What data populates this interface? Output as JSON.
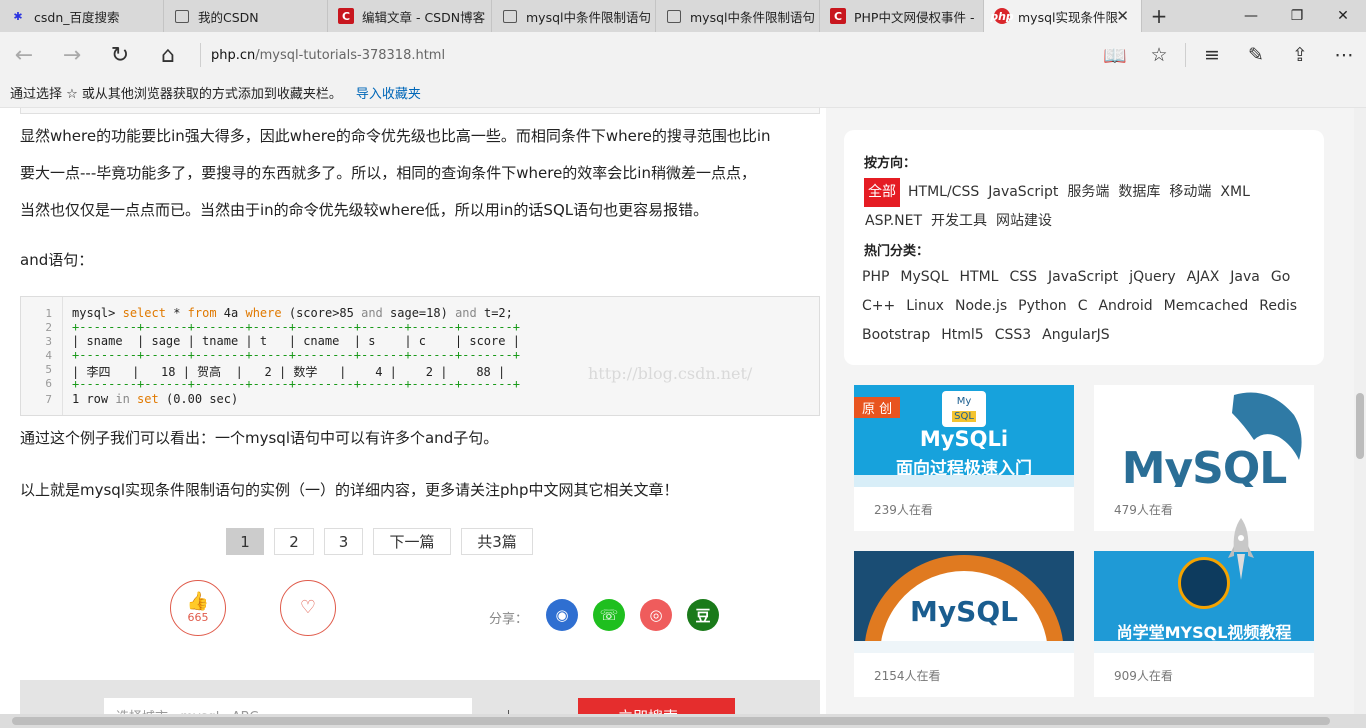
{
  "tabs": [
    {
      "label": "csdn_百度搜索",
      "favicon": "baidu-paw-icon"
    },
    {
      "label": "我的CSDN",
      "favicon": "page-icon"
    },
    {
      "label": "编辑文章 - CSDN博客",
      "favicon": "csdn-icon"
    },
    {
      "label": "mysql中条件限制语句",
      "favicon": "page-icon"
    },
    {
      "label": "mysql中条件限制语句",
      "favicon": "page-icon"
    },
    {
      "label": "PHP中文网侵权事件 -",
      "favicon": "csdn-icon"
    },
    {
      "label": "mysql实现条件限",
      "favicon": "php-icon",
      "active": true
    }
  ],
  "address": {
    "domain": "php.cn",
    "path": "/mysql-tutorials-378318.html"
  },
  "favorites_bar": {
    "text": "通过选择 ☆ 或从其他浏览器获取的方式添加到收藏夹栏。",
    "link": "导入收藏夹"
  },
  "article": {
    "para1_lines": [
      "显然where的功能要比in强大得多，因此where的命令优先级也比高一些。而相同条件下where的搜寻范围也比in",
      "要大一点---毕竟功能多了，要搜寻的东西就多了。所以，相同的查询条件下where的效率会比in稍微差一点点，",
      "当然也仅仅是一点点而已。当然由于in的命令优先级较where低，所以用in的话SQL语句也更容易报错。"
    ],
    "and_heading": "and语句：",
    "code": {
      "line_numbers": [
        "1",
        "2",
        "3",
        "4",
        "5",
        "6",
        "7"
      ],
      "query": {
        "prompt": "mysql>",
        "select": "select",
        "star": "*",
        "from": "from",
        "table": "4a",
        "where": "where",
        "cond1": "(score>85",
        "and1": "and",
        "cond2": "sage=18)",
        "and2": "and",
        "cond3": "t=2;"
      },
      "border": "+--------+------+-------+-----+--------+------+------+-------+",
      "header": "| sname  | sage | tname | t   | cname  | s    | c    | score |",
      "row": "| 李四   |   18 | 贺高  |   2 | 数学   |    4 |    2 |    88 |",
      "result": {
        "count": "1 row",
        "in": "in",
        "set": "set",
        "time": "(0.00 sec)"
      }
    },
    "watermark": "http://blog.csdn.net/",
    "para2": "通过这个例子我们可以看出：一个mysql语句中可以有许多个and子句。",
    "para3": "以上就是mysql实现条件限制语句的实例（一）的详细内容，更多请关注php中文网其它相关文章！",
    "pagination": {
      "pages": [
        "1",
        "2",
        "3"
      ],
      "next": "下一篇",
      "total": "共3篇",
      "current": "1"
    },
    "like_count": "665",
    "share_label": "分享：",
    "share_icons": [
      "qq-icon",
      "wechat-icon",
      "weibo-icon",
      "douban-icon"
    ],
    "douban_char": "豆",
    "search_placeholder": "选择城市 · mysql · ABC",
    "search_button": "立即搜索"
  },
  "sidebar": {
    "direction_label": "按方向：",
    "directions": [
      "全部",
      "HTML/CSS",
      "JavaScript",
      "服务端",
      "数据库",
      "移动端",
      "XML",
      "ASP.NET",
      "开发工具",
      "网站建设"
    ],
    "hot_label": "热门分类：",
    "hot": [
      "PHP",
      "MySQL",
      "HTML",
      "CSS",
      "JavaScript",
      "jQuery",
      "AJAX",
      "Java",
      "Go",
      "C++",
      "Linux",
      "Node.js",
      "Python",
      "C",
      "Android",
      "Memcached",
      "Redis",
      "Bootstrap",
      "Html5",
      "CSS3",
      "AngularJS"
    ],
    "cards": [
      {
        "viewers": "239人在看",
        "badge": "原 创",
        "title1": "MySQLi",
        "title2": "面向过程极速入门",
        "logo_top": "My",
        "logo_bottom": "SQL"
      },
      {
        "viewers": "479人在看",
        "logo": "MySQL"
      },
      {
        "viewers": "2154人在看",
        "logo": "MySQL"
      },
      {
        "viewers": "909人在看",
        "title": "尚学堂MYSQL视频教程"
      }
    ]
  },
  "colors": {
    "accent_red": "#e51c23",
    "link_blue": "#0067b8",
    "sql_keyword": "#e07900"
  }
}
